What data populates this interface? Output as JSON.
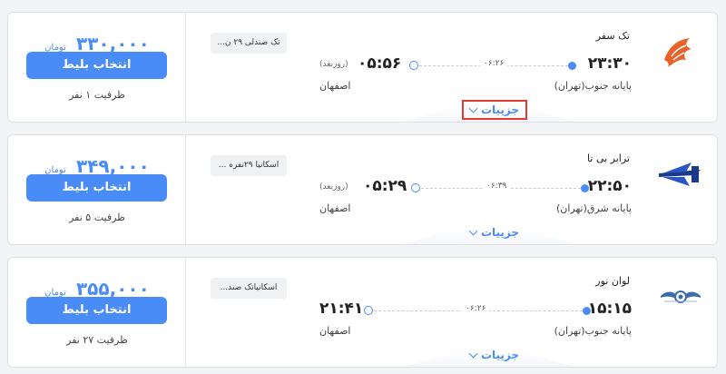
{
  "trips": [
    {
      "price": "۳۳۰,۰۰۰",
      "price_unit": "تومان",
      "select_label": "انتخاب بلیط",
      "capacity": "ظرفیت ۱ نفر",
      "bus_type": "تک صندلی ۲۹ ن...",
      "company": "تک سفر",
      "departure_time": "۲۳:۳۰",
      "arrival_time": "۰۵:۵۶",
      "next_day": "(روزبعد)",
      "duration": "۰۶:۲۶",
      "origin": "پایانه جنوب(تهران)",
      "destination": "اصفهان",
      "details_label": "جزییات",
      "logo_icon": "orange-bird-logo-icon"
    },
    {
      "price": "۳۴۹,۰۰۰",
      "price_unit": "تومان",
      "select_label": "انتخاب بلیط",
      "capacity": "ظرفیت ۵ نفر",
      "bus_type": "اسکانیا ۲۹نفره ...",
      "company": "ترابر بی تا",
      "departure_time": "۲۲:۵۰",
      "arrival_time": "۰۵:۲۹",
      "next_day": "(روزبعد)",
      "duration": "۰۶:۳۹",
      "origin": "پایانه شرق(تهران)",
      "destination": "اصفهان",
      "details_label": "جزییات",
      "logo_icon": "blue-wing-logo-icon"
    },
    {
      "price": "۳۵۵,۰۰۰",
      "price_unit": "تومان",
      "select_label": "انتخاب بلیط",
      "capacity": "ظرفیت ۲۷ نفر",
      "bus_type": "اسکانیاتک صند...",
      "company": "لوان نور",
      "departure_time": "۱۵:۱۵",
      "arrival_time": "۲۱:۴۱",
      "next_day": "",
      "duration": "۰۶:۲۶",
      "origin": "پایانه جنوب(تهران)",
      "destination": "اصفهان",
      "details_label": "جزییات",
      "logo_icon": "winged-emblem-logo-icon"
    }
  ],
  "colors": {
    "accent": "#4a8cf7",
    "highlight": "#e53935"
  }
}
